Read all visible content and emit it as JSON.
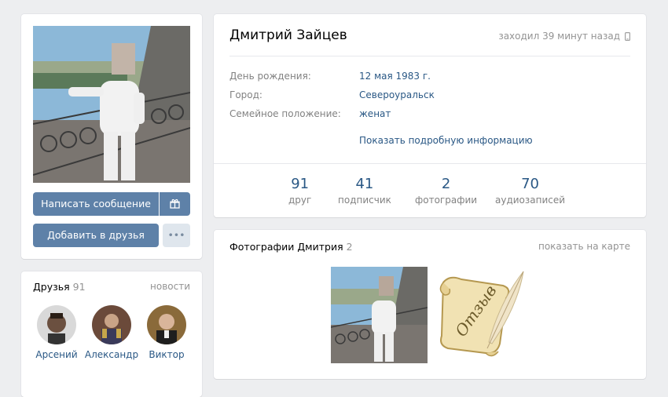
{
  "profile": {
    "name": "Дмитрий Зайцев",
    "last_seen": "заходил 39 минут назад",
    "fields": [
      {
        "label": "День рождения:",
        "value": "12 мая 1983 г."
      },
      {
        "label": "Город:",
        "value": "Североуральск"
      },
      {
        "label": "Семейное положение:",
        "value": "женат"
      }
    ],
    "show_more": "Показать подробную информацию",
    "counters": [
      {
        "num": "91",
        "label": "друг"
      },
      {
        "num": "41",
        "label": "подписчик"
      },
      {
        "num": "2",
        "label": "фотографии"
      },
      {
        "num": "70",
        "label": "аудиозаписей"
      }
    ]
  },
  "actions": {
    "message": "Написать сообщение",
    "add_friend": "Добавить в друзья",
    "more": "•••"
  },
  "friends": {
    "title": "Друзья",
    "count": "91",
    "news_link": "новости",
    "items": [
      {
        "name": "Арсений"
      },
      {
        "name": "Александр"
      },
      {
        "name": "Виктор"
      }
    ]
  },
  "photos": {
    "title": "Фотографии Дмитрия",
    "count": "2",
    "map_link": "показать на карте",
    "thumb2_text": "Отзыв"
  },
  "colors": {
    "accent": "#5e81a8",
    "link": "#2a5885",
    "background": "#edeef0"
  }
}
